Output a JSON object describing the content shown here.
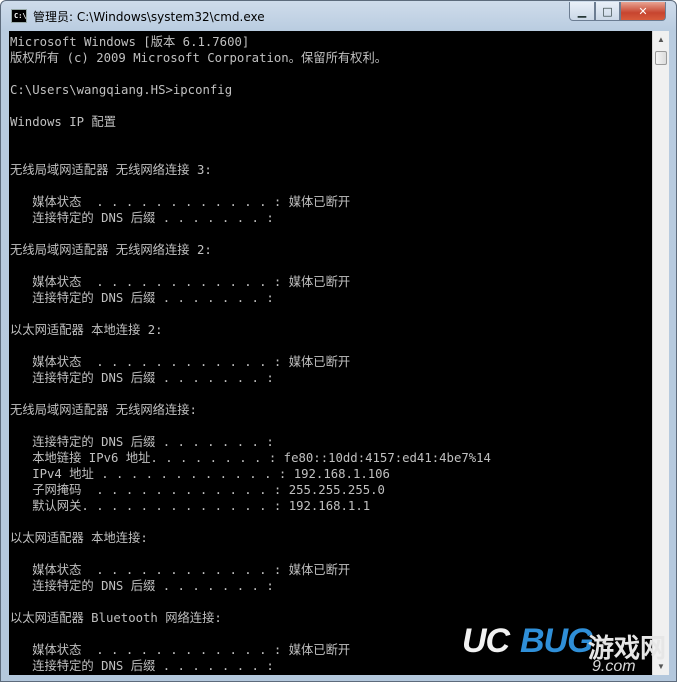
{
  "window": {
    "title": "管理员: C:\\Windows\\system32\\cmd.exe",
    "icon_label": "C:\\",
    "minimize_glyph": "▁",
    "maximize_glyph": "□",
    "close_glyph": "✕"
  },
  "console": {
    "lines": [
      "Microsoft Windows [版本 6.1.7600]",
      "版权所有 (c) 2009 Microsoft Corporation。保留所有权利。",
      "",
      "C:\\Users\\wangqiang.HS>ipconfig",
      "",
      "Windows IP 配置",
      "",
      "",
      "无线局域网适配器 无线网络连接 3:",
      "",
      "   媒体状态  . . . . . . . . . . . . : 媒体已断开",
      "   连接特定的 DNS 后缀 . . . . . . . :",
      "",
      "无线局域网适配器 无线网络连接 2:",
      "",
      "   媒体状态  . . . . . . . . . . . . : 媒体已断开",
      "   连接特定的 DNS 后缀 . . . . . . . :",
      "",
      "以太网适配器 本地连接 2:",
      "",
      "   媒体状态  . . . . . . . . . . . . : 媒体已断开",
      "   连接特定的 DNS 后缀 . . . . . . . :",
      "",
      "无线局域网适配器 无线网络连接:",
      "",
      "   连接特定的 DNS 后缀 . . . . . . . :",
      "   本地链接 IPv6 地址. . . . . . . . : fe80::10dd:4157:ed41:4be7%14",
      "   IPv4 地址 . . . . . . . . . . . . : 192.168.1.106",
      "   子网掩码  . . . . . . . . . . . . : 255.255.255.0",
      "   默认网关. . . . . . . . . . . . . : 192.168.1.1",
      "",
      "以太网适配器 本地连接:",
      "",
      "   媒体状态  . . . . . . . . . . . . : 媒体已断开",
      "   连接特定的 DNS 后缀 . . . . . . . :",
      "",
      "以太网适配器 Bluetooth 网络连接:",
      "",
      "   媒体状态  . . . . . . . . . . . . : 媒体已断开",
      "   连接特定的 DNS 后缀 . . . . . . . :"
    ]
  },
  "scrollbar": {
    "up_glyph": "▲",
    "down_glyph": "▼"
  },
  "watermark": {
    "uc": "UC",
    "bug": "BUG",
    "cn": "游戏网",
    "domain": "9.com"
  }
}
